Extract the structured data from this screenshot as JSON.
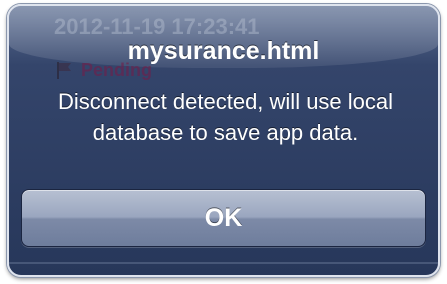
{
  "background": {
    "timestamp": "2012-11-19 17:23:41",
    "status_label": "Pending",
    "status_icon": "flag-icon"
  },
  "alert": {
    "title": "mysurance.html",
    "message": "Disconnect detected, will use local database to save app data.",
    "ok_label": "OK"
  },
  "colors": {
    "alert_top": "#5c6e92",
    "alert_body": "#27375a",
    "alert_border": "#dfe4ee",
    "button_top": "#b7c0d2",
    "button_bottom": "#6e7d9c",
    "text": "#ffffff"
  }
}
